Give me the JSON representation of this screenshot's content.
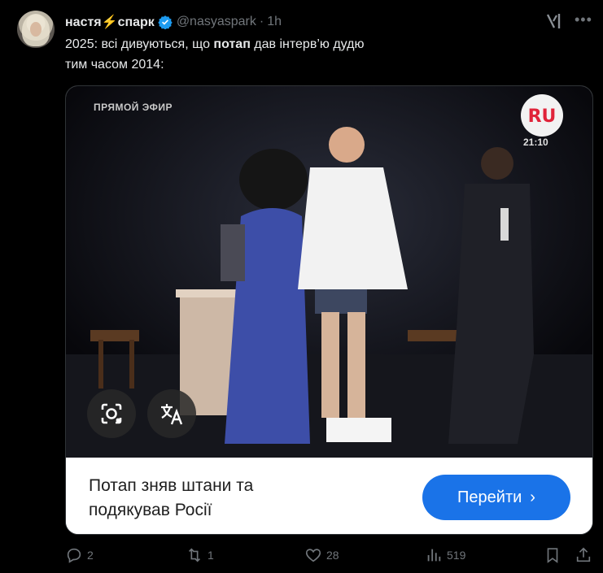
{
  "tweet": {
    "display_name_part1": "настя",
    "bolt_emoji": "⚡",
    "display_name_part2": "спарк",
    "handle": "@nasyaspark",
    "separator": "·",
    "time": "1h",
    "text_before_bold": "2025: всі дивуються, що ",
    "text_bold": "потап",
    "text_after_bold": " дав інтерв’ю дудю",
    "text_line2": "тим часом 2014:"
  },
  "card": {
    "video_overlay_top_left": "ПРЯМОЙ ЭФИР",
    "channel_logo": "RU",
    "clock": "21:10",
    "title_line1": "Потап зняв штани та",
    "title_line2": "подякував Росії",
    "button_label": "Перейти",
    "button_icon": "chevron-right-icon"
  },
  "actions": {
    "replies": "2",
    "reposts": "1",
    "likes": "28",
    "views": "519"
  },
  "colors": {
    "background": "#000000",
    "text": "#e7e9ea",
    "muted": "#71767b",
    "verified": "#1d9bf0",
    "button": "#1a73e8"
  }
}
